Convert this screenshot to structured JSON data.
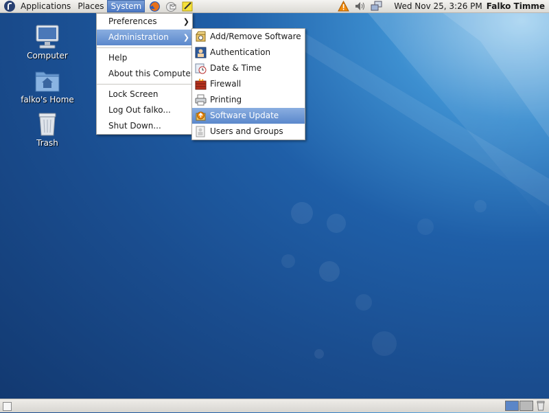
{
  "top_panel": {
    "menus": [
      "Applications",
      "Places",
      "System"
    ],
    "launchers": [
      "firefox-icon",
      "evolution-icon",
      "notes-icon"
    ],
    "tray": [
      "warning-icon",
      "volume-icon",
      "network-icon"
    ],
    "clock": "Wed Nov 25,  3:26 PM",
    "user": "Falko Timme"
  },
  "desktop": {
    "icons": [
      {
        "label": "Computer",
        "icon": "computer-icon"
      },
      {
        "label": "falko's Home",
        "icon": "home-folder-icon"
      },
      {
        "label": "Trash",
        "icon": "trash-icon"
      }
    ]
  },
  "system_menu": {
    "items": [
      "Preferences",
      "Administration",
      "Help",
      "About this Computer",
      "Lock Screen",
      "Log Out falko...",
      "Shut Down..."
    ],
    "highlighted": "Administration"
  },
  "admin_menu": {
    "items": [
      {
        "label": "Add/Remove Software",
        "icon": "package-icon"
      },
      {
        "label": "Authentication",
        "icon": "authentication-icon"
      },
      {
        "label": "Date & Time",
        "icon": "clock-icon"
      },
      {
        "label": "Firewall",
        "icon": "firewall-icon"
      },
      {
        "label": "Printing",
        "icon": "printer-icon"
      },
      {
        "label": "Software Update",
        "icon": "software-update-icon"
      },
      {
        "label": "Users and Groups",
        "icon": "users-icon"
      }
    ],
    "highlighted": "Software Update"
  },
  "colors": {
    "panel": "#dcdad5",
    "highlight": "#5b88cc",
    "desktop": "#1a4d8f"
  }
}
